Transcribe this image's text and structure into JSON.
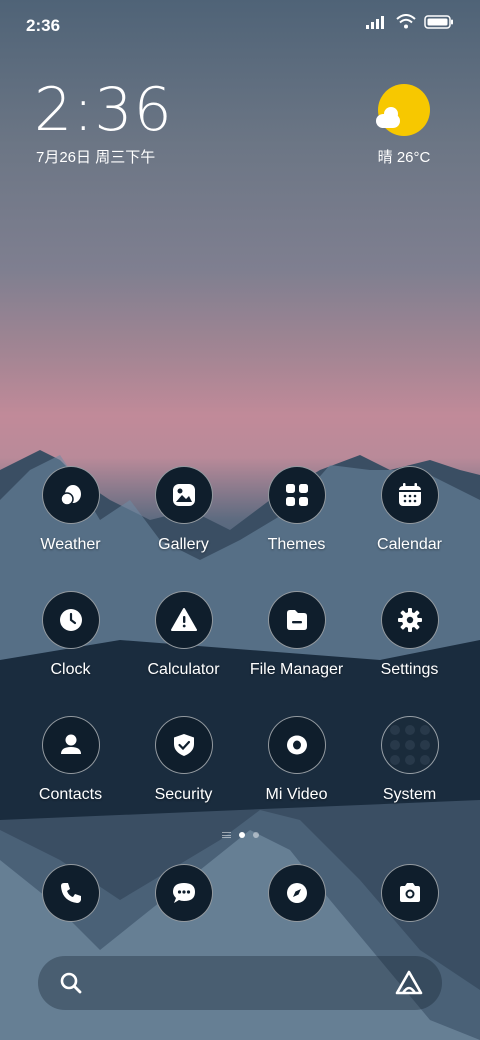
{
  "status_bar": {
    "time": "2:36"
  },
  "clock_widget": {
    "time": "2:36",
    "date": "7月26日 周三下午"
  },
  "weather_widget": {
    "temperature": "晴 26°C",
    "icon": "sun-with-cloud-icon"
  },
  "apps": [
    {
      "label": "Weather",
      "icon": "weather-icon"
    },
    {
      "label": "Gallery",
      "icon": "gallery-icon"
    },
    {
      "label": "Themes",
      "icon": "themes-icon"
    },
    {
      "label": "Calendar",
      "icon": "calendar-icon"
    },
    {
      "label": "Clock",
      "icon": "clock-icon"
    },
    {
      "label": "Calculator",
      "icon": "calculator-icon"
    },
    {
      "label": "File Manager",
      "icon": "file-manager-icon"
    },
    {
      "label": "Settings",
      "icon": "gear-icon"
    },
    {
      "label": "Contacts",
      "icon": "contacts-icon"
    },
    {
      "label": "Security",
      "icon": "shield-icon"
    },
    {
      "label": "Mi Video",
      "icon": "video-icon"
    },
    {
      "label": "System",
      "icon": "folder-icon"
    }
  ],
  "dock": [
    {
      "icon": "phone-icon"
    },
    {
      "icon": "messages-icon"
    },
    {
      "icon": "browser-compass-icon"
    },
    {
      "icon": "camera-icon"
    }
  ],
  "colors": {
    "icon_bg": "#0f1e2c",
    "sun": "#f7c800"
  }
}
